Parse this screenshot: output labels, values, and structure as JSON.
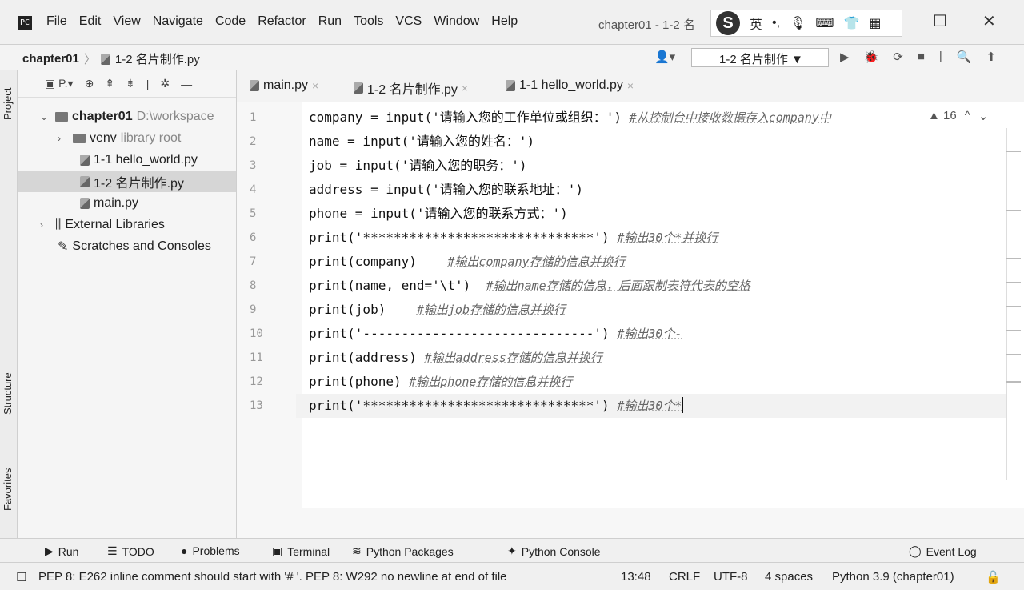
{
  "menu": {
    "items": [
      {
        "key": "F",
        "rest": "ile"
      },
      {
        "key": "E",
        "rest": "dit"
      },
      {
        "key": "V",
        "rest": "iew"
      },
      {
        "key": "N",
        "rest": "avigate"
      },
      {
        "key": "C",
        "rest": "ode"
      },
      {
        "key": "R",
        "rest": "efactor"
      },
      {
        "pre": "R",
        "key": "u",
        "rest": "n"
      },
      {
        "key": "T",
        "rest": "ools"
      },
      {
        "pre": "VC",
        "key": "S",
        "rest": ""
      },
      {
        "key": "W",
        "rest": "indow"
      },
      {
        "key": "H",
        "rest": "elp"
      }
    ],
    "window_title": "chapter01 - 1-2 名",
    "ime": {
      "logo": "S",
      "lang": "英",
      "punct": "•,",
      "mic": "🎙",
      "keyboard": "⌨",
      "shirt": "👕",
      "grid": "▦"
    },
    "win_minimize": "—",
    "win_maximize": "☐",
    "win_close": "✕"
  },
  "nav": {
    "project": "chapter01",
    "separator": "〉",
    "file": "1-2 名片制作.py",
    "user_icon": "👤▾",
    "run_config": "1-2 名片制作 ▼",
    "tools": [
      "▶",
      "🐞",
      "⟳",
      "■",
      "|",
      "🔍",
      "⬆"
    ]
  },
  "stripe": {
    "project": "Project",
    "structure": "Structure",
    "favorites": "Favorites"
  },
  "project_panel": {
    "toolbar": [
      "▣ P.▾",
      "⊕",
      "⇞",
      "⇟",
      "|",
      "✲",
      "—"
    ],
    "tree": [
      {
        "chev": "⌄",
        "icon": "folder",
        "label": "chapter01",
        "extra": "D:\\workspace",
        "bold": true,
        "indent": 0
      },
      {
        "chev": "›",
        "icon": "folder",
        "label": "venv",
        "extra": "library root",
        "bold": false,
        "indent": 1
      },
      {
        "chev": "",
        "icon": "py",
        "label": "1-1 hello_world.py",
        "extra": "",
        "bold": false,
        "indent": 2
      },
      {
        "chev": "",
        "icon": "py",
        "label": "1-2 名片制作.py",
        "extra": "",
        "bold": false,
        "indent": 2,
        "selected": true
      },
      {
        "chev": "",
        "icon": "py",
        "label": "main.py",
        "extra": "",
        "bold": false,
        "indent": 2
      },
      {
        "chev": "›",
        "icon": "lib",
        "label": "External Libraries",
        "extra": "",
        "bold": false,
        "indent": 0
      },
      {
        "chev": "",
        "icon": "scratch",
        "label": "Scratches and Consoles",
        "extra": "",
        "bold": false,
        "indent": 1
      }
    ]
  },
  "tabs": [
    {
      "label": "main.py",
      "close": "×"
    },
    {
      "label": "1-2 名片制作.py",
      "close": "×",
      "active": true
    },
    {
      "label": "1-1 hello_world.py",
      "close": "×"
    }
  ],
  "inspection": {
    "count": "▲ 16",
    "up": "^",
    "down": "⌄"
  },
  "code": [
    {
      "num": "1",
      "code": "company = input('请输入您的工作单位或组织：') ",
      "comment": "#从控制台中接收数据存入company中"
    },
    {
      "num": "2",
      "code": "name = input('请输入您的姓名：')",
      "comment": ""
    },
    {
      "num": "3",
      "code": "job = input('请输入您的职务：')",
      "comment": ""
    },
    {
      "num": "4",
      "code": "address = input('请输入您的联系地址：')",
      "comment": ""
    },
    {
      "num": "5",
      "code": "phone = input('请输入您的联系方式：')",
      "comment": ""
    },
    {
      "num": "6",
      "code": "print('******************************') ",
      "comment": "#输出30个*并换行"
    },
    {
      "num": "7",
      "code": "print(company)    ",
      "comment": "#输出company存储的信息并换行"
    },
    {
      "num": "8",
      "code": "print(name, end='\\t')  ",
      "comment": "#输出name存储的信息，后面跟制表符代表的空格"
    },
    {
      "num": "9",
      "code": "print(job)    ",
      "comment": "#输出job存储的信息并换行"
    },
    {
      "num": "10",
      "code": "print('------------------------------') ",
      "comment": "#输出30个-"
    },
    {
      "num": "11",
      "code": "print(address) ",
      "comment": "#输出address存储的信息并换行"
    },
    {
      "num": "12",
      "code": "print(phone) ",
      "comment": "#输出phone存储的信息并换行"
    },
    {
      "num": "13",
      "code": "print('******************************') ",
      "comment": "#输出30个*",
      "current": true
    }
  ],
  "tool_windows": [
    {
      "icon": "▶",
      "label": "Run"
    },
    {
      "icon": "☰",
      "label": "TODO"
    },
    {
      "icon": "●",
      "label": "Problems"
    },
    {
      "icon": "▣",
      "label": "Terminal"
    },
    {
      "icon": "≋",
      "label": "Python Packages"
    },
    {
      "icon": "✦",
      "label": "Python Console"
    }
  ],
  "event_log": {
    "icon": "◯",
    "label": "Event Log"
  },
  "status": {
    "message": "PEP 8: E262 inline comment should start with '# '. PEP 8: W292 no newline at end of file",
    "position": "13:48",
    "line_sep": "CRLF",
    "encoding": "UTF-8",
    "indent": "4 spaces",
    "interpreter": "Python 3.9 (chapter01)",
    "lock": "🔓",
    "panel_icon": "☐"
  }
}
